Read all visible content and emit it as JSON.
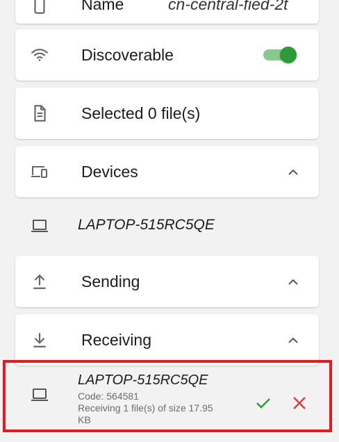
{
  "settings": {
    "name_label": "Name",
    "name_value": "cn-central-fied-2t",
    "discoverable_label": "Discoverable",
    "discoverable_on": true,
    "files_label": "Selected 0 file(s)"
  },
  "sections": {
    "devices_label": "Devices",
    "sending_label": "Sending",
    "receiving_label": "Receiving"
  },
  "devices": [
    {
      "name": "LAPTOP-515RC5QE"
    }
  ],
  "receiving": {
    "device_name": "LAPTOP-515RC5QE",
    "code": "Code: 564581",
    "status": "Receiving 1 file(s) of size 17.95 KB"
  },
  "colors": {
    "toggle_track": "#86c98a",
    "toggle_knob": "#2e9a3a",
    "accept": "#2e9a3a",
    "reject": "#e23b3b",
    "highlight": "#e21b1b"
  }
}
